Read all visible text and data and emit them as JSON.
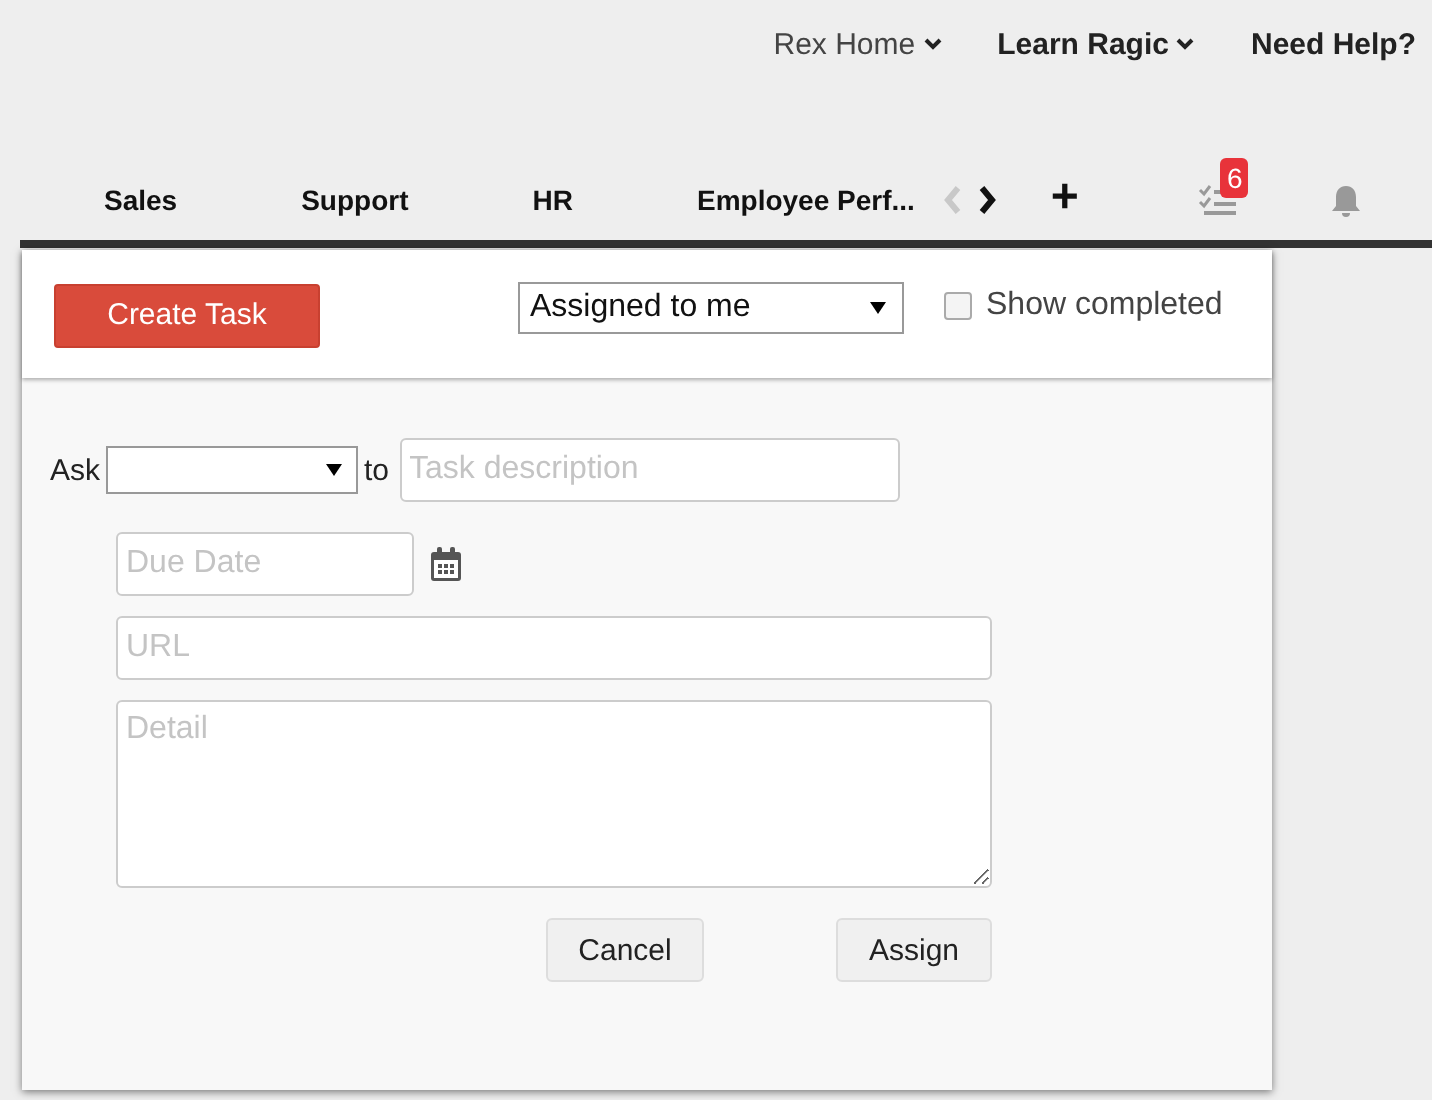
{
  "top_nav": [
    {
      "label": "Rex Home",
      "kind": "account"
    },
    {
      "label": "Learn Ragic",
      "kind": "menu"
    },
    {
      "label": "Need Help?",
      "kind": "link"
    }
  ],
  "tabs": [
    {
      "label": "Sales"
    },
    {
      "label": "Support"
    },
    {
      "label": "HR"
    },
    {
      "label": "Employee Perf..."
    }
  ],
  "tab_scroll": {
    "prev_disabled": true,
    "next_disabled": false
  },
  "add_tab": "+",
  "tasks_badge": "6",
  "panel": {
    "create_button": "Create Task",
    "filter": {
      "value": "Assigned to me"
    },
    "show_completed": {
      "label": "Show completed",
      "checked": false
    }
  },
  "form": {
    "ask_label": "Ask",
    "to_label": "to",
    "description": {
      "placeholder": "Task description"
    },
    "due_date": {
      "placeholder": "Due Date"
    },
    "url": {
      "placeholder": "URL"
    },
    "detail": {
      "placeholder": "Detail"
    },
    "buttons": [
      {
        "label": "Cancel",
        "kind": "cancel"
      },
      {
        "label": "Assign",
        "kind": "submit"
      }
    ]
  }
}
